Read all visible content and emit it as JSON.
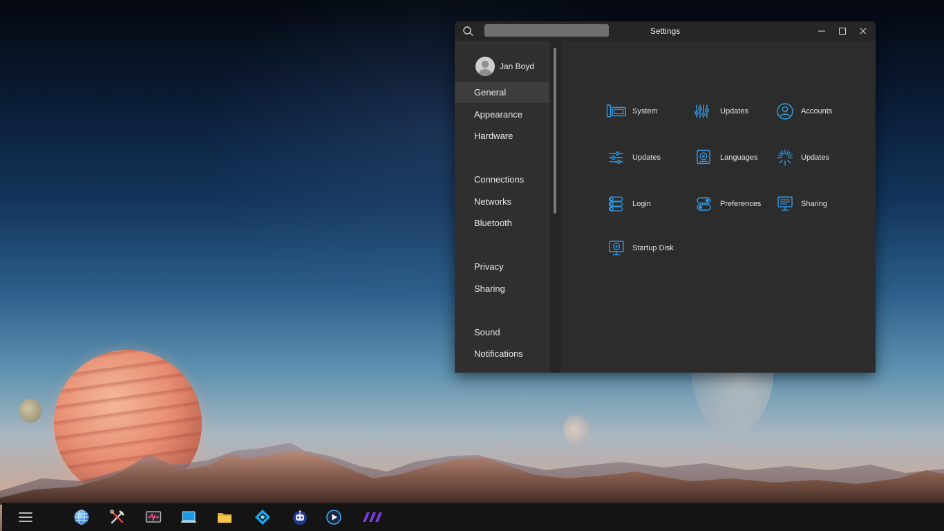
{
  "window": {
    "title": "Settings",
    "search_placeholder": "",
    "controls": {
      "minimize": "minimize-icon",
      "maximize": "maximize-icon",
      "close": "close-icon"
    }
  },
  "sidebar": {
    "user": {
      "name": "Jan Boyd",
      "avatar_icon": "user-avatar-icon"
    },
    "active_item": "General",
    "items": [
      {
        "label": "General"
      },
      {
        "label": "Appearance"
      },
      {
        "label": "Hardware"
      },
      {
        "label": "Connections"
      },
      {
        "label": "Networks"
      },
      {
        "label": "Bluetooth"
      },
      {
        "label": "Privacy"
      },
      {
        "label": "Sharing"
      },
      {
        "label": "Sound"
      },
      {
        "label": "Notifications"
      }
    ]
  },
  "content": {
    "accent_color": "#2f9be8",
    "tiles": [
      {
        "label": "System",
        "icon": "system-devices-icon"
      },
      {
        "label": "Updates",
        "icon": "sliders-vertical-icon"
      },
      {
        "label": "Accounts",
        "icon": "account-circle-icon"
      },
      {
        "label": "Updates",
        "icon": "sliders-horizontal-icon"
      },
      {
        "label": "Languages",
        "icon": "languages-icon"
      },
      {
        "label": "Updates",
        "icon": "sunburst-icon"
      },
      {
        "label": "Login",
        "icon": "list-toggle-icon"
      },
      {
        "label": "Preferences",
        "icon": "toggles-icon"
      },
      {
        "label": "Sharing",
        "icon": "monitor-share-icon"
      },
      {
        "label": "Startup Disk",
        "icon": "startup-disk-icon"
      }
    ]
  },
  "taskbar": {
    "menu_icon": "hamburger-menu-icon",
    "apps": [
      {
        "icon": "globe-browser-icon"
      },
      {
        "icon": "tools-icon"
      },
      {
        "icon": "system-monitor-icon"
      },
      {
        "icon": "laptop-icon"
      },
      {
        "icon": "folder-icon"
      },
      {
        "icon": "diamond-app-icon"
      },
      {
        "icon": "robot-app-icon"
      },
      {
        "icon": "media-player-icon"
      },
      {
        "icon": "stripes-app-icon"
      }
    ]
  }
}
